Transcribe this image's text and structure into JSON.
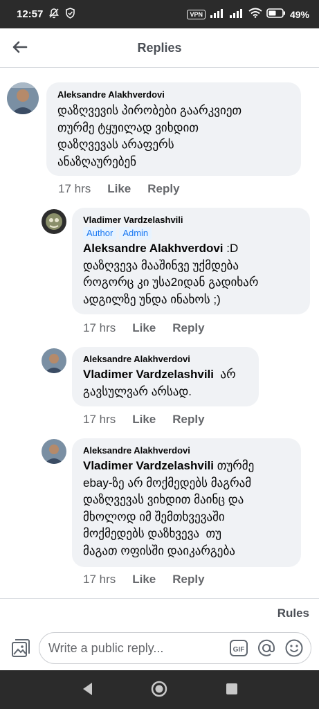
{
  "status_bar": {
    "time": "12:57",
    "vpn": "VPN",
    "battery": "49%"
  },
  "header": {
    "title": "Replies"
  },
  "comments": [
    {
      "author": "Aleksandre Alakhverdovi",
      "lines": [
        "დაზღვევის პირობები გაარკვიეთ",
        "თურმე ტყუილად ვიხდით",
        "დაზღვევას არაფერს",
        "ანაზღაურებენ"
      ],
      "time": "17 hrs",
      "like": "Like",
      "reply": "Reply"
    },
    {
      "author": "Vladimer Vardzelashvili",
      "badges": [
        "Author",
        "Admin"
      ],
      "mention": "Aleksandre Alakhverdovi",
      "first_line_rest": " :D",
      "lines": [
        "დაზღვევა მააშინვე უქმდება",
        "როგორც კი უსა2იდან გადიხარ",
        "ადგილზე უნდა ინახოს ;)"
      ],
      "time": "17 hrs",
      "like": "Like",
      "reply": "Reply"
    },
    {
      "author": "Aleksandre Alakhverdovi",
      "mention": "Vladimer Vardzelashvili",
      "first_line_rest": "  არ",
      "lines": [
        "გავსულვარ არსად."
      ],
      "time": "17 hrs",
      "like": "Like",
      "reply": "Reply"
    },
    {
      "author": "Aleksandre Alakhverdovi",
      "mention": "Vladimer Vardzelashvili",
      "first_line_rest": " თურმე",
      "lines": [
        "ebay-ზე არ მოქმედებს მაგრამ",
        "დაზღვევას ვიხდით მაინც და",
        "მხოლოდ იმ შემთხვევაში",
        "მოქმედებს დაზხვევა  თუ",
        "მაგათ ოფისში დაიკარგება"
      ],
      "time": "17 hrs",
      "like": "Like",
      "reply": "Reply"
    }
  ],
  "rules_label": "Rules",
  "composer": {
    "placeholder": "Write a public reply..."
  },
  "icons": {
    "back": "arrow-left-icon",
    "gallery": "gallery-icon",
    "gif": "gif-icon",
    "mention": "at-icon",
    "emoji": "emoji-icon"
  },
  "colors": {
    "badge_text": "#1877f2",
    "badge_bg": "#e7f3ff",
    "bubble_bg": "#f0f2f5",
    "meta_text": "#65676b"
  }
}
